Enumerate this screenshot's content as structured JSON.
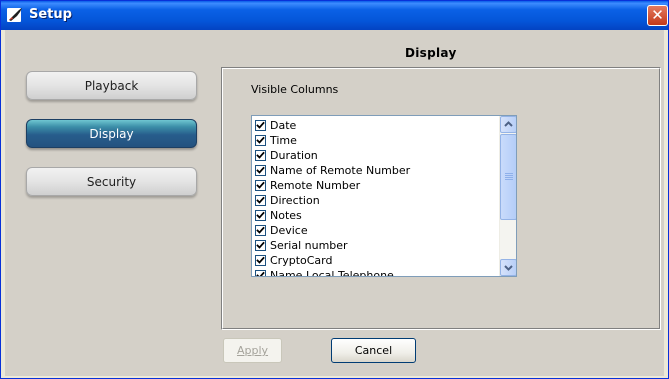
{
  "window": {
    "title": "Setup",
    "close_glyph": "✕",
    "icon": "app-icon"
  },
  "header": {
    "section_title": "Display"
  },
  "nav": {
    "items": [
      {
        "label": "Playback",
        "active": false
      },
      {
        "label": "Display",
        "active": true
      },
      {
        "label": "Security",
        "active": false
      }
    ]
  },
  "panel": {
    "group_label": "Visible Columns",
    "columns": [
      {
        "label": "Date",
        "checked": true
      },
      {
        "label": "Time",
        "checked": true
      },
      {
        "label": "Duration",
        "checked": true
      },
      {
        "label": "Name of Remote Number",
        "checked": true
      },
      {
        "label": "Remote Number",
        "checked": true
      },
      {
        "label": "Direction",
        "checked": true
      },
      {
        "label": "Notes",
        "checked": true
      },
      {
        "label": "Device",
        "checked": true
      },
      {
        "label": "Serial number",
        "checked": true
      },
      {
        "label": "CryptoCard",
        "checked": true
      },
      {
        "label": "Name Local Telephone",
        "checked": true
      }
    ]
  },
  "footer": {
    "apply_label": "Apply",
    "apply_enabled": false,
    "cancel_label": "Cancel"
  },
  "colors": {
    "titlebar": "#0455d8",
    "active_nav": "#275d8c",
    "client_bg": "#d4d0c8"
  }
}
